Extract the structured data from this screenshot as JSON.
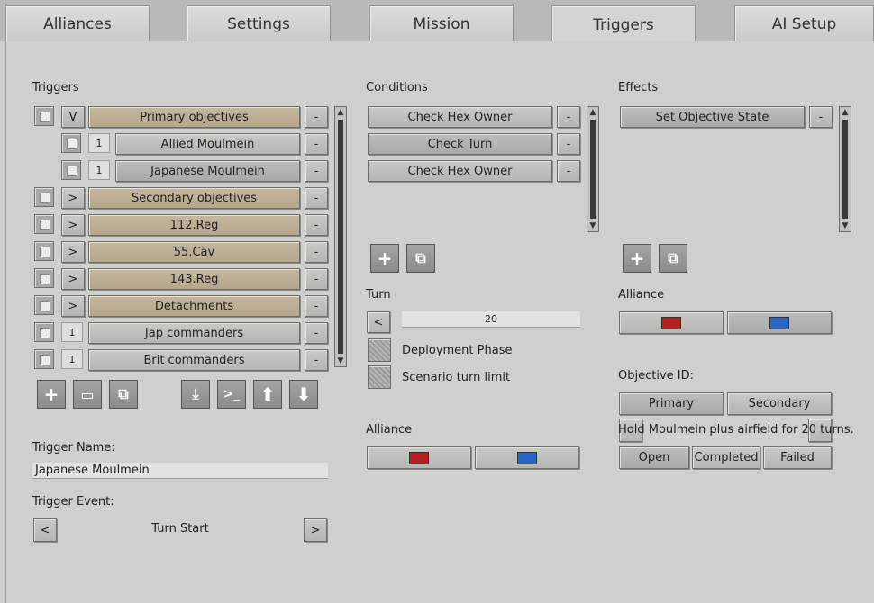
{
  "tabs": [
    "Alliances",
    "Settings",
    "Mission",
    "Triggers",
    "AI Setup"
  ],
  "triggers": {
    "header": "Triggers",
    "rows": [
      {
        "toggle": "V",
        "label": "Primary objectives",
        "style": "tan"
      },
      {
        "toggle": "1",
        "label": "Allied Moulmein",
        "style": "grey"
      },
      {
        "toggle": "1",
        "label": "Japanese Moulmein",
        "style": "dark"
      },
      {
        "toggle": ">",
        "label": "Secondary objectives",
        "style": "tan"
      },
      {
        "toggle": ">",
        "label": "112.Reg",
        "style": "tan"
      },
      {
        "toggle": ">",
        "label": "55.Cav",
        "style": "tan"
      },
      {
        "toggle": ">",
        "label": "143.Reg",
        "style": "tan"
      },
      {
        "toggle": ">",
        "label": "Detachments",
        "style": "tan"
      },
      {
        "toggle": "1",
        "label": "Jap commanders",
        "style": "grey"
      },
      {
        "toggle": "1",
        "label": "Brit commanders",
        "style": "grey"
      }
    ],
    "remove_label": "-",
    "name_label": "Trigger Name:",
    "name_value": "Japanese Moulmein",
    "event_label": "Trigger Event:",
    "event_value": "Turn Start",
    "prev": "<",
    "next": ">"
  },
  "conditions": {
    "header": "Conditions",
    "items": [
      "Check Hex Owner",
      "Check Turn",
      "Check Hex Owner"
    ],
    "remove_label": "-",
    "turn_label": "Turn",
    "turn_prev": "<",
    "turn_value": "20",
    "option1": "Deployment Phase",
    "option2": "Scenario turn limit",
    "alliance_label": "Alliance"
  },
  "effects": {
    "header": "Effects",
    "items": [
      "Set Objective State"
    ],
    "remove_label": "-",
    "alliance_label": "Alliance",
    "objective_label": "Objective ID:",
    "primary": "Primary",
    "secondary": "Secondary",
    "objective_text": "Hold Moulmein plus airfield  for 20 turns.",
    "states": [
      "Open",
      "Completed",
      "Failed"
    ]
  },
  "colors": {
    "red": "#b02020",
    "blue": "#2a64c4"
  }
}
